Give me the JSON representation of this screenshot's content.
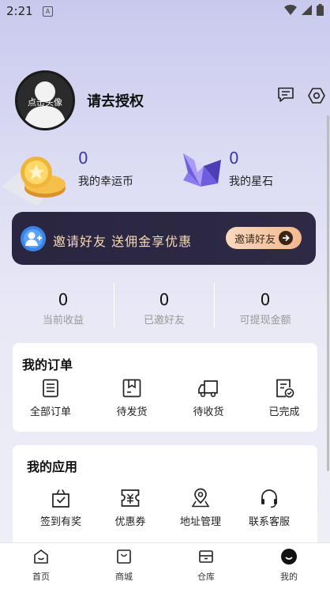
{
  "status_bar": {
    "time": "2:21",
    "notification_letter": "A"
  },
  "profile": {
    "avatar_label": "点击头像",
    "username": "请去授权"
  },
  "stats": {
    "lucky_coin": {
      "value": "0",
      "label": "我的幸运币"
    },
    "star_stone": {
      "value": "0",
      "label": "我的星石"
    }
  },
  "banner": {
    "text": "邀请好友  送佣金享优惠",
    "button": "邀请好友"
  },
  "earnings": [
    {
      "value": "0",
      "label": "当前收益"
    },
    {
      "value": "0",
      "label": "已邀好友"
    },
    {
      "value": "0",
      "label": "可提现金额"
    }
  ],
  "orders": {
    "title": "我的订单",
    "items": [
      {
        "label": "全部订单",
        "icon": "list-doc-icon"
      },
      {
        "label": "待发货",
        "icon": "package-icon"
      },
      {
        "label": "待收货",
        "icon": "truck-icon"
      },
      {
        "label": "已完成",
        "icon": "doc-check-icon"
      }
    ]
  },
  "apps": {
    "title": "我的应用",
    "items": [
      {
        "label": "签到有奖",
        "icon": "gift-bag-icon"
      },
      {
        "label": "优惠券",
        "icon": "coupon-icon"
      },
      {
        "label": "地址管理",
        "icon": "location-pin-icon"
      },
      {
        "label": "联系客服",
        "icon": "headset-icon"
      }
    ]
  },
  "tabs": [
    {
      "label": "首页",
      "icon": "home-icon"
    },
    {
      "label": "商城",
      "icon": "shopping-bag-icon"
    },
    {
      "label": "仓库",
      "icon": "warehouse-icon"
    },
    {
      "label": "我的",
      "icon": "profile-icon",
      "active": true
    }
  ],
  "colors": {
    "accent": "#3a3aa0",
    "banner_bg": "#2a2540",
    "banner_text": "#f7d9b5"
  }
}
